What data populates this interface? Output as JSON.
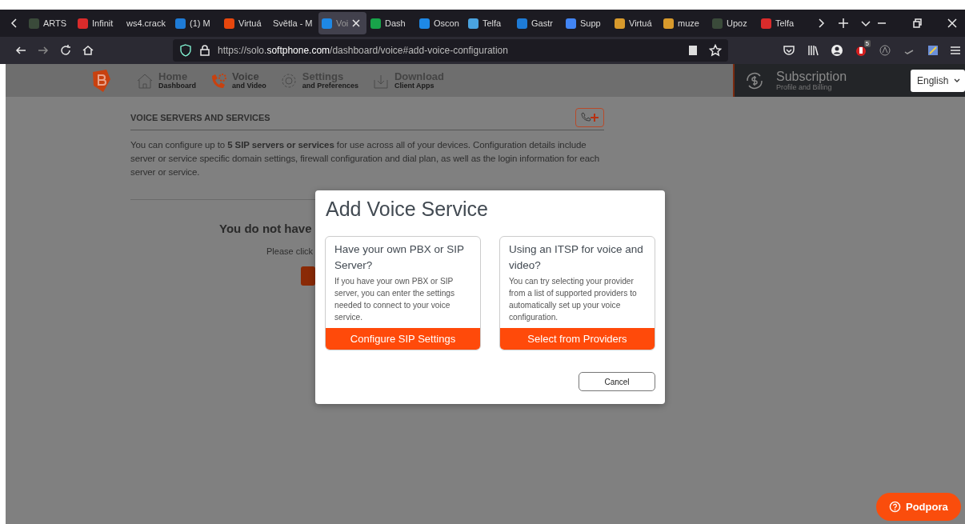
{
  "browser": {
    "tabs": [
      {
        "label": "ARTS",
        "kind": "icon",
        "selected": false
      },
      {
        "label": "Infinit",
        "kind": "icon",
        "selected": false
      },
      {
        "label": "ws4.crack",
        "kind": "text",
        "selected": false
      },
      {
        "label": "(1) M",
        "kind": "icon",
        "selected": false
      },
      {
        "label": "Virtuá",
        "kind": "icon",
        "selected": false
      },
      {
        "label": "Světla - M",
        "kind": "text",
        "selected": false
      },
      {
        "label": "Voi",
        "kind": "icon",
        "selected": true
      },
      {
        "label": "Dash",
        "kind": "icon",
        "selected": false
      },
      {
        "label": "Oscon",
        "kind": "icon",
        "selected": false
      },
      {
        "label": "Telfa",
        "kind": "icon",
        "selected": false
      },
      {
        "label": "Gastr",
        "kind": "icon",
        "selected": false
      },
      {
        "label": "Supp",
        "kind": "icon",
        "selected": false
      },
      {
        "label": "Virtuá",
        "kind": "icon",
        "selected": false
      },
      {
        "label": "muze",
        "kind": "icon",
        "selected": false
      },
      {
        "label": "Upoz",
        "kind": "icon",
        "selected": false
      },
      {
        "label": "Telfa",
        "kind": "icon",
        "selected": false
      }
    ],
    "url": {
      "host_pre": "https://solo.",
      "host": "softphone.com",
      "path": "/dashboard/voice#add-voice-configuration"
    },
    "extension_badge": "5"
  },
  "site_header": {
    "nav": [
      {
        "title": "Home",
        "subtitle": "Dashboard",
        "selected": false
      },
      {
        "title": "Voice",
        "subtitle": "and Video",
        "selected": true
      },
      {
        "title": "Settings",
        "subtitle": "and Preferences",
        "selected": false
      },
      {
        "title": "Download",
        "subtitle": "Client Apps",
        "selected": false
      }
    ],
    "subscription": {
      "title": "Subscription",
      "subtitle": "Profile and Billing"
    },
    "language": "English"
  },
  "page": {
    "heading": "VOICE SERVERS AND SERVICES",
    "description": "You can configure up to **5 SIP servers or services** for use across all of your devices. Configuration details include server or service specific domain settings, firewall configuration and dial plan, as well as the login information for each server or service.",
    "empty_title": "You do not have",
    "empty_hint": "Please click"
  },
  "dialog": {
    "title": "Add Voice Service",
    "options": [
      {
        "title": "Have your own PBX or SIP Server?",
        "text": "If you have your own PBX or SIP server, you can enter the settings needed to connect to your voice service.",
        "button": "Configure SIP Settings"
      },
      {
        "title": "Using an ITSP for voice and video?",
        "text": "You can try selecting your provider from a list of supported providers to automatically set up your voice configuration.",
        "button": "Select from Providers"
      }
    ],
    "cancel": "Cancel"
  },
  "support_button": "Podpora"
}
